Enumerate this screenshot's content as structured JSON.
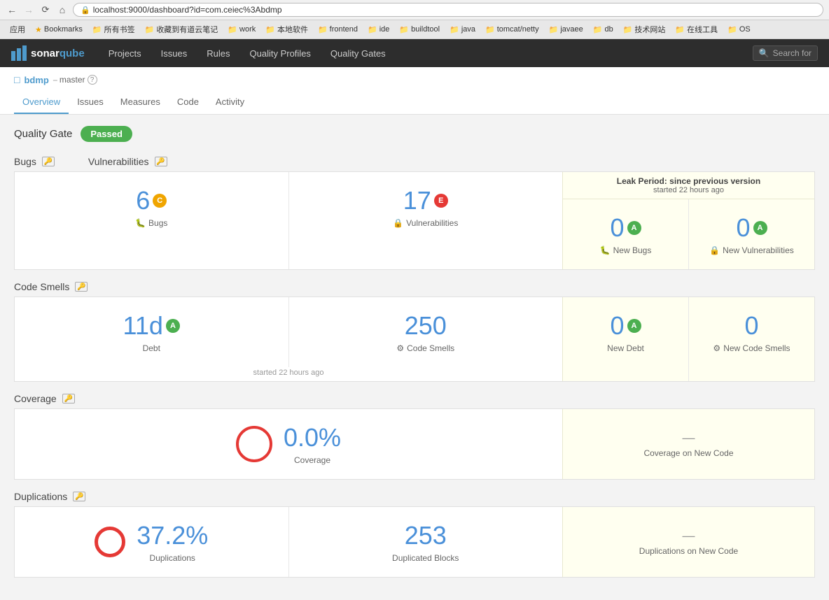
{
  "browser": {
    "url": "localhost:9000/dashboard?id=com.ceiec%3Abdmp",
    "bookmarks": [
      "应用",
      "Bookmarks",
      "所有书签",
      "收藏到有道云笔记",
      "work",
      "本地软件",
      "frontend",
      "ide",
      "buildtool",
      "java",
      "tomcat/netty",
      "javaee",
      "db",
      "技术网站",
      "在线工具",
      "OS"
    ]
  },
  "nav": {
    "logo": "sonarqube",
    "items": [
      "Projects",
      "Issues",
      "Rules",
      "Quality Profiles",
      "Quality Gates"
    ],
    "search_placeholder": "Search for"
  },
  "project": {
    "name": "bdmp",
    "branch": "master",
    "tabs": [
      "Overview",
      "Issues",
      "Measures",
      "Code",
      "Activity"
    ]
  },
  "quality_gate": {
    "label": "Quality Gate",
    "status": "Passed"
  },
  "leak_period": {
    "title": "Leak Period: since previous version",
    "subtitle": "started 22 hours ago"
  },
  "bugs_section": {
    "label": "Bugs",
    "vuln_label": "Vulnerabilities",
    "bugs_value": "6",
    "bugs_rating": "C",
    "vuln_value": "17",
    "vuln_rating": "E",
    "new_bugs_value": "0",
    "new_bugs_rating": "A",
    "new_bugs_label": "New Bugs",
    "new_vuln_value": "0",
    "new_vuln_rating": "A",
    "new_vuln_label": "New Vulnerabilities"
  },
  "code_smells_section": {
    "label": "Code Smells",
    "debt_value": "11d",
    "debt_rating": "A",
    "debt_label": "Debt",
    "smells_value": "250",
    "smells_label": "Code Smells",
    "started_text": "started 22 hours ago",
    "new_debt_value": "0",
    "new_debt_rating": "A",
    "new_debt_label": "New Debt",
    "new_smells_value": "0",
    "new_smells_label": "New Code Smells"
  },
  "coverage_section": {
    "label": "Coverage",
    "value": "0.0%",
    "sub_label": "Coverage",
    "new_label": "Coverage on New Code",
    "new_value": "—"
  },
  "duplications_section": {
    "label": "Duplications",
    "value": "37.2%",
    "sub_label": "Duplications",
    "blocks_value": "253",
    "blocks_label": "Duplicated Blocks",
    "new_label": "Duplications on New Code",
    "new_value": "—"
  }
}
